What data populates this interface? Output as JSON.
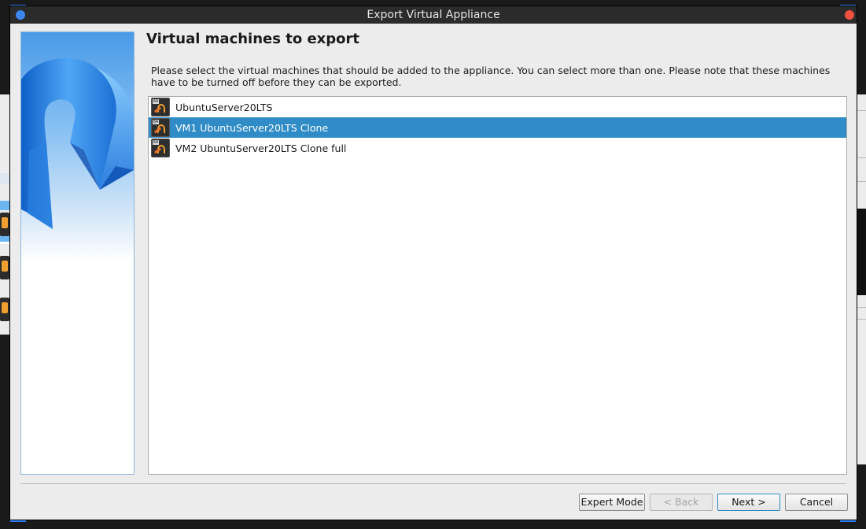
{
  "window": {
    "title": "Export Virtual Appliance"
  },
  "page": {
    "heading": "Virtual machines to export",
    "description": "Please select the virtual machines that should be added to the appliance. You can select more than one. Please note that these machines have to be turned off before they can be exported."
  },
  "vm_list": {
    "items": [
      {
        "label": "UbuntuServer20LTS",
        "os_badge": "64",
        "selected": false
      },
      {
        "label": "VM1 UbuntuServer20LTS Clone",
        "os_badge": "64",
        "selected": true
      },
      {
        "label": "VM2 UbuntuServer20LTS Clone full",
        "os_badge": "64",
        "selected": false
      }
    ]
  },
  "buttons": {
    "expert_mode": "Expert Mode",
    "back": "< Back",
    "next": "Next >",
    "cancel": "Cancel"
  },
  "colors": {
    "selection": "#308cc6",
    "titlebar": "#2b2b2b",
    "close_dot": "#f05040",
    "menu_dot": "#3c86f0"
  }
}
